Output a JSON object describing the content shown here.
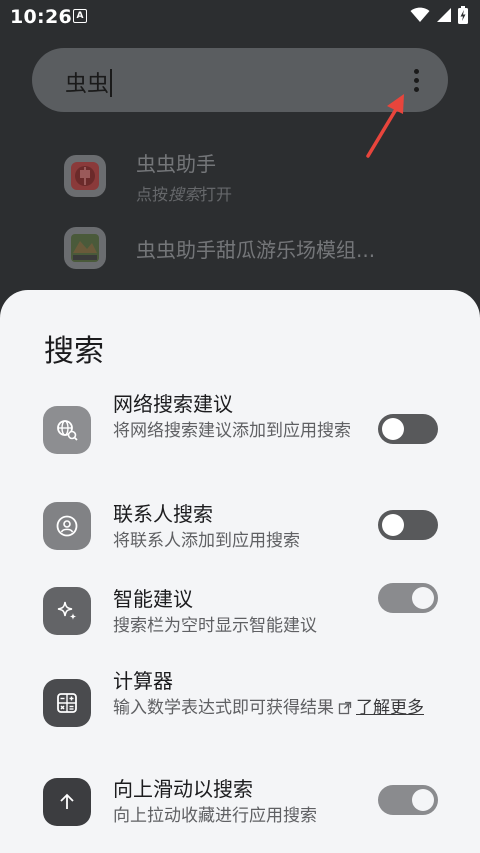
{
  "status_bar": {
    "time": "10:26",
    "notif_letter": "A"
  },
  "search": {
    "query": "虫虫"
  },
  "results": [
    {
      "title": "虫虫助手",
      "subtitle_prefix": "点按",
      "subtitle_em": "搜索",
      "subtitle_suffix": "打开"
    },
    {
      "title": "虫虫助手甜瓜游乐场模组..."
    }
  ],
  "sheet": {
    "title": "搜索",
    "settings": [
      {
        "title": "网络搜索建议",
        "desc": "将网络搜索建议添加到应用搜索",
        "toggle": "off",
        "icon": "web-search-icon"
      },
      {
        "title": "联系人搜索",
        "desc": "将联系人添加到应用搜索",
        "toggle": "off",
        "icon": "contact-icon"
      },
      {
        "title": "智能建议",
        "desc": "搜索栏为空时显示智能建议",
        "toggle": "on",
        "icon": "sparkle-icon"
      },
      {
        "title": "计算器",
        "desc": "输入数学表达式即可获得结果",
        "link": "了解更多",
        "icon": "calculator-icon"
      },
      {
        "title": "向上滑动以搜索",
        "desc": "向上拉动收藏进行应用搜索",
        "toggle": "on",
        "icon": "arrow-up-icon"
      }
    ]
  },
  "colors": {
    "sheet_bg": "#f4f5f7",
    "backdrop": "#2c2e30",
    "arrow": "#e8453c"
  }
}
